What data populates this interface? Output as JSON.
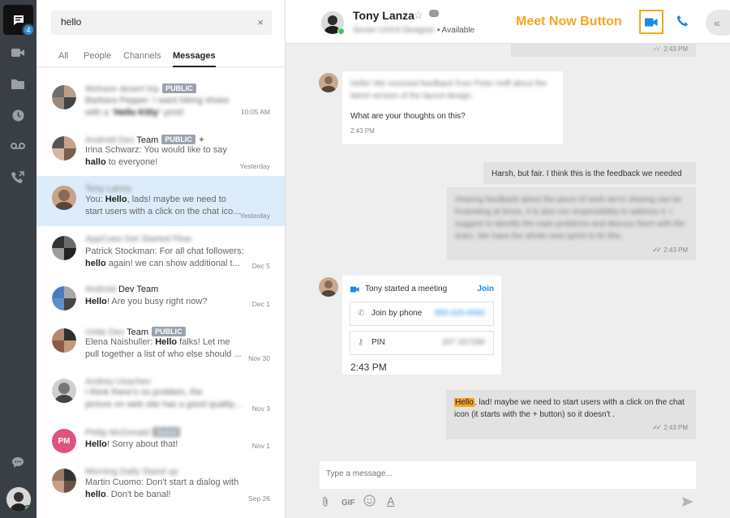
{
  "rail": {
    "badge_count": "4",
    "items": [
      "video-icon",
      "folder-icon",
      "clock-icon",
      "voicemail-icon",
      "phone-forward-icon"
    ],
    "bottom_item": "chat-bubble-icon"
  },
  "search": {
    "value": "hello",
    "clear_symbol": "×"
  },
  "tabs": [
    "All",
    "People",
    "Channels",
    "Messages"
  ],
  "conversations": [
    {
      "title_blur": "Mohave desert trip",
      "tag": "PUBLIC",
      "line1_blur": "Barbara Pepper: I want hiking shoes",
      "line2_blur": "with a",
      "line2_bold": "Hello Kitty",
      "line2_rest": "print!",
      "date": "10:05 AM"
    },
    {
      "title_blur": "Android Dev",
      "title_plain": "Team",
      "tag": "PUBLIC",
      "line1": "Irina Schwarz: You would like to say",
      "line2_bold": "hallo",
      "line2_rest": " to everyone!",
      "date": "Yesterday"
    },
    {
      "title_blur": "Tony Lanza",
      "line1_pre": "You: ",
      "line1_bold": "Hello",
      "line1_rest": ", lads! maybe we need to",
      "line2": "start users with a click on the chat ico...",
      "date": "Yesterday"
    },
    {
      "title_blur": "AppCues Get Started Flow",
      "line1": "Patrick Stockman: For all chat followers:",
      "line2_bold": "hello",
      "line2_rest": " again! we can show additional t...",
      "date": "Dec 5"
    },
    {
      "title_blur": "Android",
      "title_plain": "Dev Team",
      "line1_bold": "Hello",
      "line1_rest": "! Are you busy right now?",
      "date": "Dec 1"
    },
    {
      "title_blur": "Unite Dev",
      "title_plain": "Team",
      "tag": "PUBLIC",
      "line1_pre": "Elena Naishuller: ",
      "line1_bold": "Hello",
      "line1_rest": " falks! Let me",
      "line2": "pull together a list of who else should ...",
      "date": "Nov 30"
    },
    {
      "title_blur": "Andrey Usachev",
      "line1_blur": "I think there's no problem, the",
      "line2_blur": "picture on web site has a good quality...",
      "date": "Nov 3"
    },
    {
      "title_blur": "Philip McDonald",
      "tag_blur": "Guest",
      "initials": "PM",
      "line1_bold": "Hello",
      "line1_rest": "! Sorry about that!",
      "date": "Nov 1"
    },
    {
      "title_blur": "Morning Daily Stand up",
      "line1": "Martin Cuomo: Don't start a dialog with",
      "line2_bold": "hello",
      "line2_rest": ". Don't be banal!",
      "date": "Sep 26"
    }
  ],
  "header": {
    "name": "Tony Lanza",
    "title_blur": "Senior UX/UI Designer",
    "status": "Available",
    "annotation": "Meet Now Button"
  },
  "messages": {
    "top_time": "2:43 PM",
    "m1_blur": "Hello! We received feedback from Peter Hoff about the latest version of the layout design.",
    "m1_text": "What are your thoughts on this?",
    "m1_time": "2:43 PM",
    "m2_text": "Harsh, but fair. I think this is the feedback we needed",
    "m3_blur": "Hearing feedback about the piece of work we're sharing can be frustrating at times, it is also our responsibility to address it. I suggest to identify the main problems and discuss them with the team. We have the whole next sprint to fix this.",
    "m3_time": "2:43 PM",
    "meeting_text": "Tony started a meeting",
    "meeting_join": "Join",
    "join_phone": "Join by phone",
    "phone_blur": "650-426-0092",
    "pin_label": "PIN",
    "pin_blur": "207 33728#",
    "meeting_time": "2:43 PM",
    "m4_highlight": "Hello",
    "m4_text": ", lad! maybe we need to start users with a click on the chat icon (it starts with the + button) so it doesn't .",
    "m4_time": "2:43 PM"
  },
  "composer": {
    "placeholder": "Type a message...",
    "gif": "GIF",
    "text_tool": "A"
  }
}
